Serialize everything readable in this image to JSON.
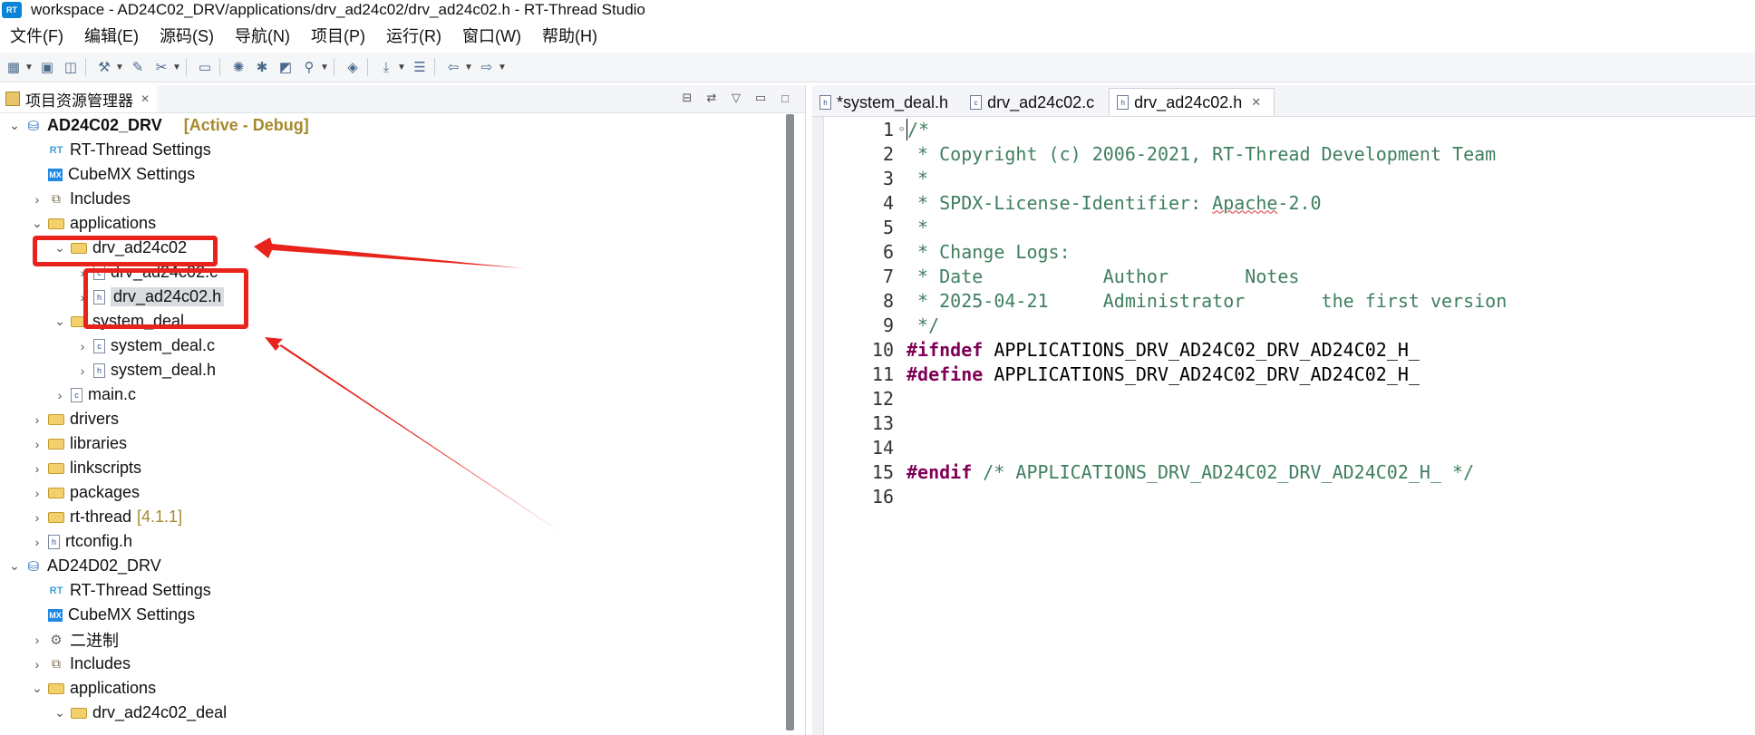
{
  "window": {
    "title": "workspace - AD24C02_DRV/applications/drv_ad24c02/drv_ad24c02.h - RT-Thread Studio",
    "logo_text": "RT"
  },
  "menu": [
    "文件(F)",
    "编辑(E)",
    "源码(S)",
    "导航(N)",
    "项目(P)",
    "运行(R)",
    "窗口(W)",
    "帮助(H)"
  ],
  "toolbar": {
    "icons": [
      "new-icon",
      "save-icon",
      "save-all-icon",
      "build-icon",
      "clean-icon",
      "tools-icon",
      "monitor-icon",
      "settings-icon",
      "debug-icon",
      "open-icon",
      "search-icon",
      "sdk-icon",
      "download-icon",
      "layers-icon",
      "back-icon",
      "forward-icon"
    ]
  },
  "explorer": {
    "tab_label": "项目资源管理器",
    "close_glyph": "✕",
    "tree": [
      {
        "depth": 0,
        "expanded": "open",
        "icon": "project",
        "label": "AD24C02_DRV",
        "bold": true,
        "decor": "[Active - Debug]"
      },
      {
        "depth": 1,
        "expanded": "none",
        "icon": "rt",
        "label": "RT-Thread Settings"
      },
      {
        "depth": 1,
        "expanded": "none",
        "icon": "mx",
        "label": "CubeMX Settings"
      },
      {
        "depth": 1,
        "expanded": "closed",
        "icon": "includes",
        "label": "Includes"
      },
      {
        "depth": 1,
        "expanded": "open",
        "icon": "folder",
        "label": "applications"
      },
      {
        "depth": 2,
        "expanded": "open",
        "icon": "folder",
        "label": "drv_ad24c02"
      },
      {
        "depth": 3,
        "expanded": "closed",
        "icon": "c",
        "label": "drv_ad24c02.c"
      },
      {
        "depth": 3,
        "expanded": "closed",
        "icon": "h",
        "label": "drv_ad24c02.h",
        "selected": true
      },
      {
        "depth": 2,
        "expanded": "open",
        "icon": "folder",
        "label": "system_deal"
      },
      {
        "depth": 3,
        "expanded": "closed",
        "icon": "c",
        "label": "system_deal.c"
      },
      {
        "depth": 3,
        "expanded": "closed",
        "icon": "h",
        "label": "system_deal.h"
      },
      {
        "depth": 2,
        "expanded": "closed",
        "icon": "c",
        "label": "main.c"
      },
      {
        "depth": 1,
        "expanded": "closed",
        "icon": "folder",
        "label": "drivers"
      },
      {
        "depth": 1,
        "expanded": "closed",
        "icon": "folder",
        "label": "libraries"
      },
      {
        "depth": 1,
        "expanded": "closed",
        "icon": "folder",
        "label": "linkscripts"
      },
      {
        "depth": 1,
        "expanded": "closed",
        "icon": "folder",
        "label": "packages"
      },
      {
        "depth": 1,
        "expanded": "closed",
        "icon": "folder",
        "label": "rt-thread",
        "decor_plain": "[4.1.1]"
      },
      {
        "depth": 1,
        "expanded": "closed",
        "icon": "h",
        "label": "rtconfig.h"
      },
      {
        "depth": 0,
        "expanded": "open",
        "icon": "project",
        "label": "AD24D02_DRV"
      },
      {
        "depth": 1,
        "expanded": "none",
        "icon": "rt",
        "label": "RT-Thread Settings"
      },
      {
        "depth": 1,
        "expanded": "none",
        "icon": "mx",
        "label": "CubeMX Settings"
      },
      {
        "depth": 1,
        "expanded": "closed",
        "icon": "binary",
        "label": "二进制"
      },
      {
        "depth": 1,
        "expanded": "closed",
        "icon": "includes",
        "label": "Includes"
      },
      {
        "depth": 1,
        "expanded": "open",
        "icon": "folder",
        "label": "applications"
      },
      {
        "depth": 2,
        "expanded": "open",
        "icon": "folder",
        "label": "drv_ad24c02_deal"
      }
    ]
  },
  "editor": {
    "tabs": [
      {
        "label": "*system_deal.h",
        "icon": "h",
        "active": false
      },
      {
        "label": "drv_ad24c02.c",
        "icon": "c",
        "active": false
      },
      {
        "label": "drv_ad24c02.h",
        "icon": "h",
        "active": true
      }
    ],
    "close_glyph": "✕",
    "lines": [
      {
        "n": "1",
        "parts": [
          {
            "t": "/*",
            "c": "comment"
          }
        ],
        "fold": "⊖"
      },
      {
        "n": "2",
        "parts": [
          {
            "t": " * Copyright (c) 2006-2021, RT-Thread Development Team",
            "c": "comment"
          }
        ]
      },
      {
        "n": "3",
        "parts": [
          {
            "t": " *",
            "c": "comment"
          }
        ]
      },
      {
        "n": "4",
        "parts": [
          {
            "t": " * SPDX-License-Identifier: ",
            "c": "comment"
          },
          {
            "t": "Apache",
            "c": "comment-squiggle"
          },
          {
            "t": "-2.0",
            "c": "comment"
          }
        ]
      },
      {
        "n": "5",
        "parts": [
          {
            "t": " *",
            "c": "comment"
          }
        ]
      },
      {
        "n": "6",
        "parts": [
          {
            "t": " * Change Logs:",
            "c": "comment"
          }
        ]
      },
      {
        "n": "7",
        "parts": [
          {
            "t": " * Date           Author       Notes",
            "c": "comment"
          }
        ]
      },
      {
        "n": "8",
        "parts": [
          {
            "t": " * 2025-04-21     Administrator       the first version",
            "c": "comment"
          }
        ]
      },
      {
        "n": "9",
        "parts": [
          {
            "t": " */",
            "c": "comment"
          }
        ]
      },
      {
        "n": "10",
        "parts": [
          {
            "t": "#ifndef",
            "c": "kw"
          },
          {
            "t": " APPLICATIONS_DRV_AD24C02_DRV_AD24C02_H_",
            "c": "plain"
          }
        ]
      },
      {
        "n": "11",
        "parts": [
          {
            "t": "#define",
            "c": "kw"
          },
          {
            "t": " APPLICATIONS_DRV_AD24C02_DRV_AD24C02_H_",
            "c": "plain"
          }
        ]
      },
      {
        "n": "12",
        "parts": []
      },
      {
        "n": "13",
        "parts": []
      },
      {
        "n": "14",
        "parts": []
      },
      {
        "n": "15",
        "parts": [
          {
            "t": "#endif",
            "c": "kw"
          },
          {
            "t": " /* APPLICATIONS_DRV_AD24C02_DRV_AD24C02_H_ */",
            "c": "comment"
          }
        ]
      },
      {
        "n": "16",
        "parts": []
      }
    ]
  },
  "annotations": {
    "color": "#e8231b"
  }
}
